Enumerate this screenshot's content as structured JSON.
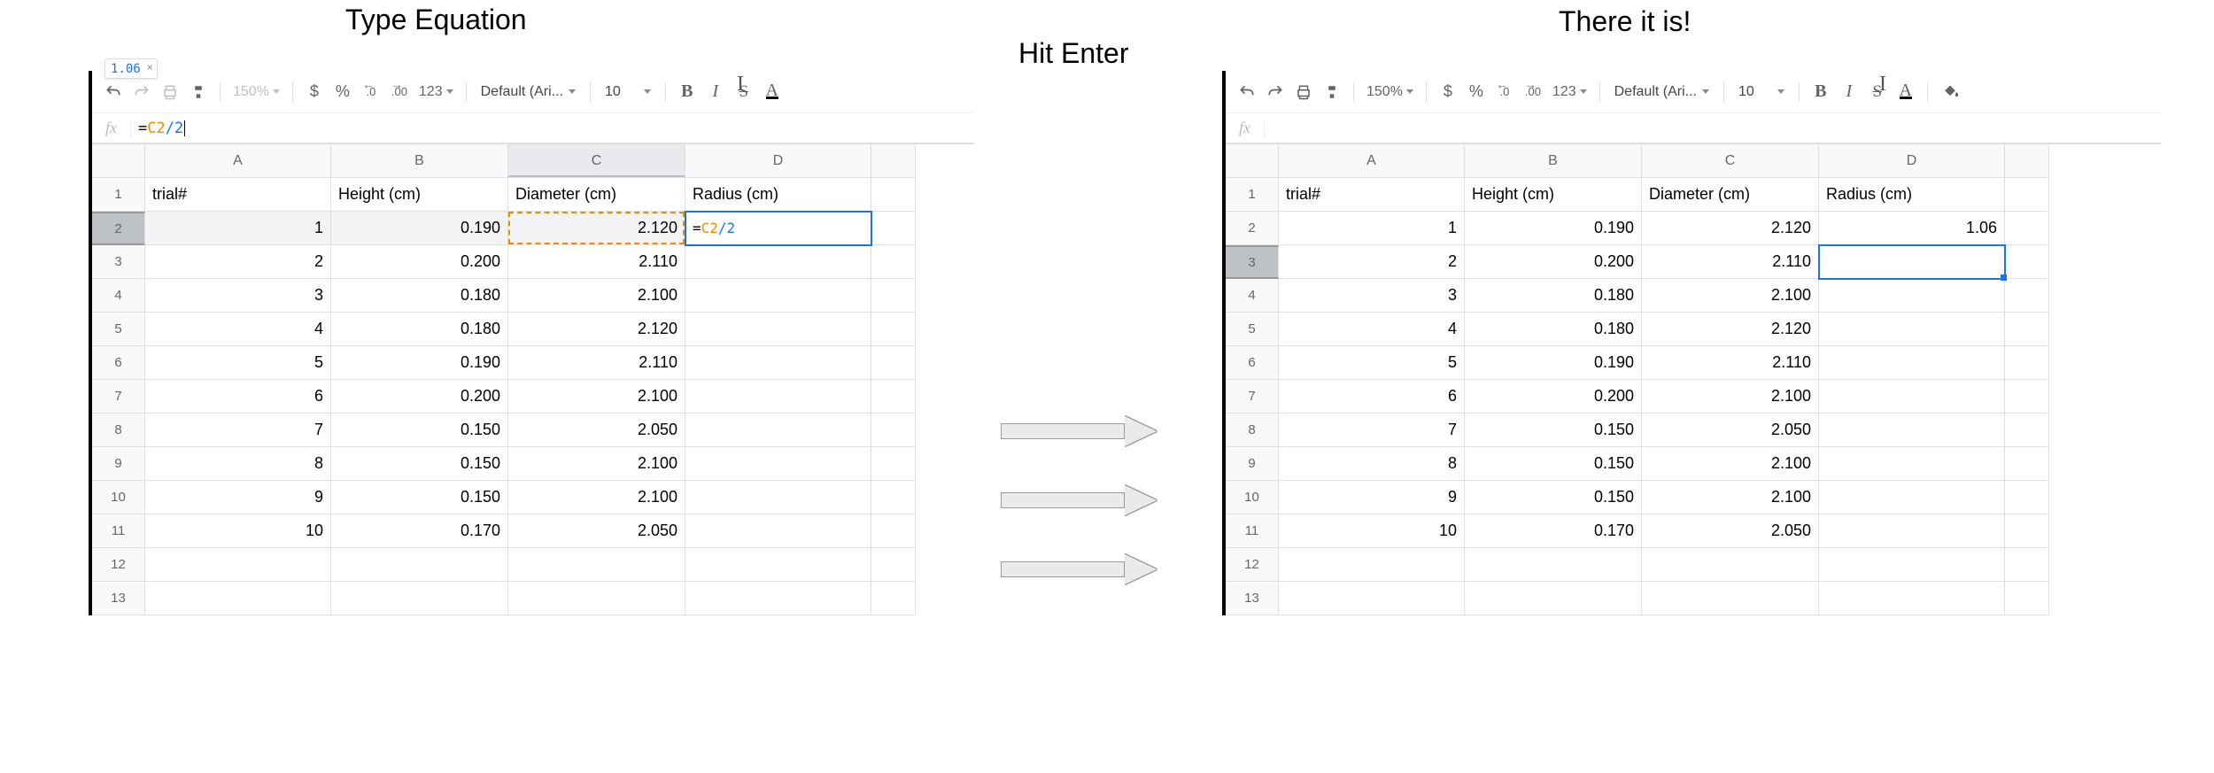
{
  "titles": {
    "left": "Type Equation",
    "middle": "Hit Enter",
    "right": "There it is!"
  },
  "toolbar": {
    "zoom": "150%",
    "currency": "$",
    "percent": "%",
    "dec_dec": ".0",
    "inc_dec": ".00",
    "numfmt": "123",
    "font": "Default (Ari...",
    "size": "10",
    "bold": "B",
    "italic": "I",
    "strike": "S",
    "textcolor": "A"
  },
  "chip": {
    "value": "1.06",
    "close": "×"
  },
  "left": {
    "fx": "=C2/2",
    "selectedRow": 2,
    "selectedCol": "C",
    "formulaCell": {
      "row": 2,
      "col": "D",
      "text": "=C2/2"
    },
    "dashedCell": {
      "row": 2,
      "col": "C"
    }
  },
  "right": {
    "fx": "",
    "selectedRow": 3,
    "selectedCell": {
      "row": 3,
      "col": "D"
    }
  },
  "columns": [
    "A",
    "B",
    "C",
    "D"
  ],
  "headers": {
    "A": "trial#",
    "B": "Height (cm)",
    "C": "Diameter (cm)",
    "D": "Radius (cm)"
  },
  "right_d2": "1.06",
  "rows": [
    {
      "n": 1,
      "A": "1",
      "B": "0.190",
      "C": "2.120"
    },
    {
      "n": 2,
      "A": "2",
      "B": "0.200",
      "C": "2.110"
    },
    {
      "n": 3,
      "A": "3",
      "B": "0.180",
      "C": "2.100"
    },
    {
      "n": 4,
      "A": "4",
      "B": "0.180",
      "C": "2.120"
    },
    {
      "n": 5,
      "A": "5",
      "B": "0.190",
      "C": "2.110"
    },
    {
      "n": 6,
      "A": "6",
      "B": "0.200",
      "C": "2.100"
    },
    {
      "n": 7,
      "A": "7",
      "B": "0.150",
      "C": "2.050"
    },
    {
      "n": 8,
      "A": "8",
      "B": "0.150",
      "C": "2.100"
    },
    {
      "n": 9,
      "A": "9",
      "B": "0.150",
      "C": "2.100"
    },
    {
      "n": 10,
      "A": "10",
      "B": "0.170",
      "C": "2.050"
    },
    {
      "n": 11,
      "A": "",
      "B": "",
      "C": ""
    },
    {
      "n": 12,
      "A": "",
      "B": "",
      "C": ""
    }
  ],
  "chart_data": {
    "type": "table",
    "columns": [
      "trial#",
      "Height (cm)",
      "Diameter (cm)",
      "Radius (cm)"
    ],
    "rows": [
      [
        1,
        0.19,
        2.12,
        1.06
      ],
      [
        2,
        0.2,
        2.11,
        null
      ],
      [
        3,
        0.18,
        2.1,
        null
      ],
      [
        4,
        0.18,
        2.12,
        null
      ],
      [
        5,
        0.19,
        2.11,
        null
      ],
      [
        6,
        0.2,
        2.1,
        null
      ],
      [
        7,
        0.15,
        2.05,
        null
      ],
      [
        8,
        0.15,
        2.1,
        null
      ],
      [
        9,
        0.15,
        2.1,
        null
      ],
      [
        10,
        0.17,
        2.05,
        null
      ]
    ],
    "formula": "Radius = Diameter / 2"
  }
}
